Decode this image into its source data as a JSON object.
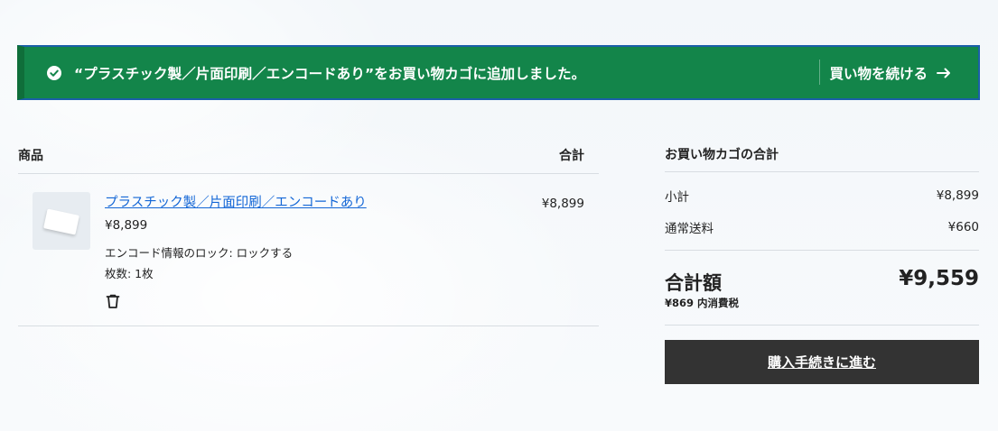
{
  "notice": {
    "message": "“プラスチック製／片面印刷／エンコードあり”をお買い物カゴに追加しました。",
    "continue_label": "買い物を続ける",
    "icons": {
      "status": "check-circle-icon",
      "continue": "arrow-right-icon"
    }
  },
  "cart": {
    "headers": {
      "product": "商品",
      "total": "合計"
    },
    "items": [
      {
        "name": "プラスチック製／片面印刷／エンコードあり",
        "price": "¥8,899",
        "option": "エンコード情報のロック: ロックする",
        "quantity": "枚数: 1枚",
        "total": "¥8,899",
        "remove_icon": "trash-icon"
      }
    ]
  },
  "summary": {
    "title": "お買い物カゴの合計",
    "subtotal_label": "小計",
    "subtotal_value": "¥8,899",
    "shipping_label": "通常送料",
    "shipping_value": "¥660",
    "grand_label": "合計額",
    "grand_value": "¥9,559",
    "tax_note": "¥869 内消費税",
    "checkout_label": "購入手続きに進む"
  },
  "colors": {
    "notice_bg": "#13854a",
    "notice_border": "#1a5fa8",
    "link": "#1366d6",
    "checkout_bg": "#333333"
  }
}
